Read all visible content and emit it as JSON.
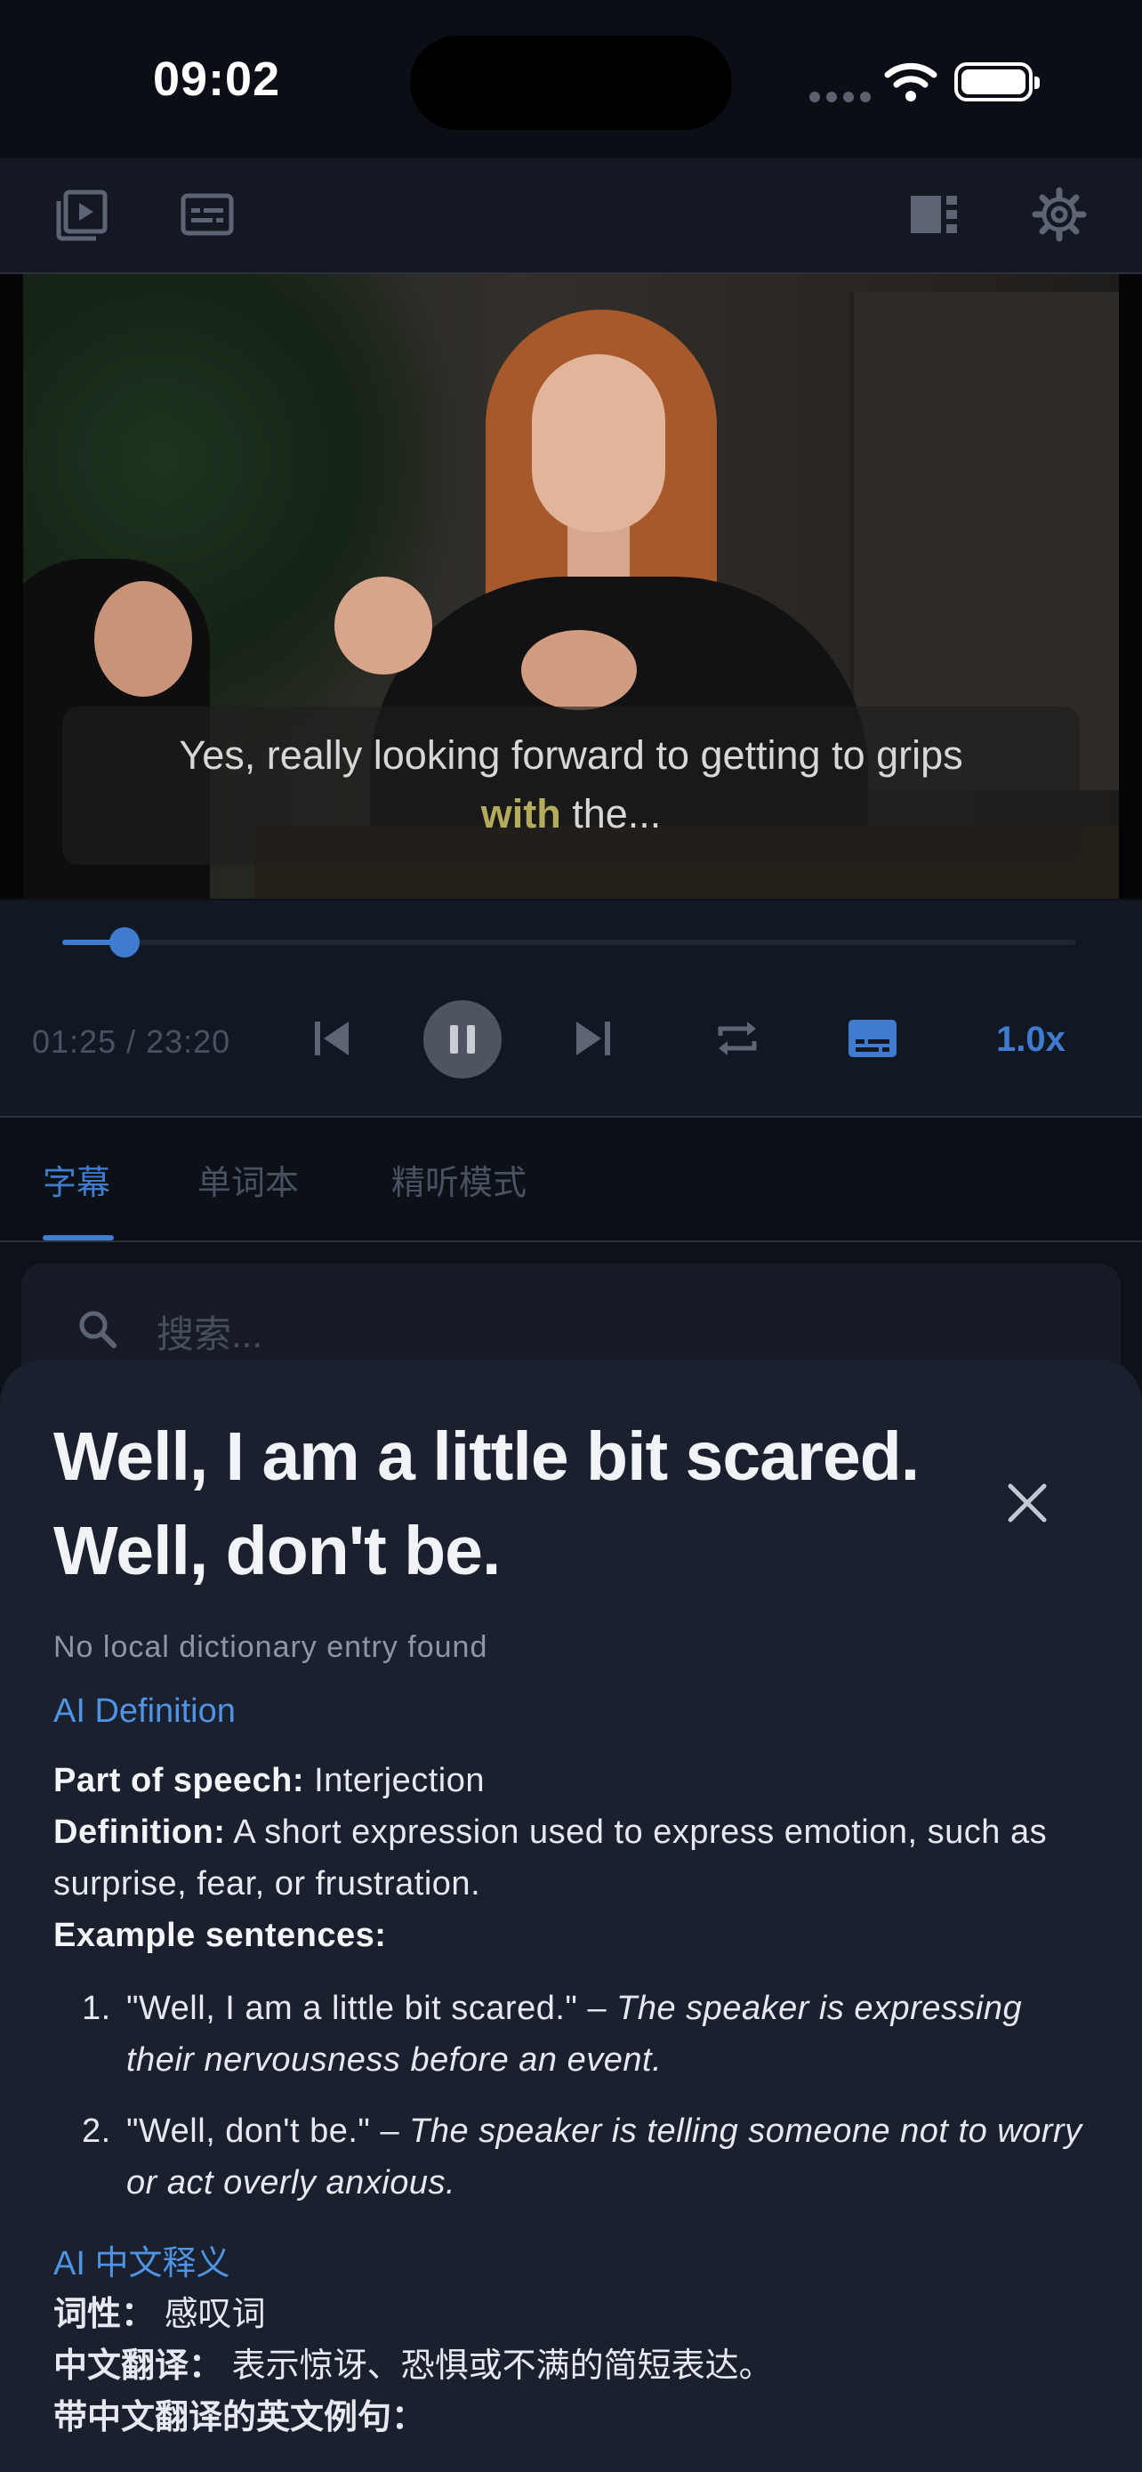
{
  "status_bar": {
    "time": "09:02"
  },
  "player": {
    "subtitle_before": "Yes, really looking forward to getting to grips",
    "subtitle_highlight": "with",
    "subtitle_after": " the...",
    "time_readout": "01:25 / 23:20",
    "progress_fraction": 0.061,
    "speed": "1.0x"
  },
  "tabs": [
    {
      "label": "字幕",
      "active": true
    },
    {
      "label": "单词本",
      "active": false
    },
    {
      "label": "精听模式",
      "active": false
    }
  ],
  "search": {
    "placeholder": "搜索..."
  },
  "sheet": {
    "title": "Well, I am a little bit scared. Well, don't be.",
    "no_entry": "No local dictionary entry found",
    "ai_definition_heading": "AI Definition",
    "pos_label": "Part of speech:",
    "pos_value": " Interjection",
    "def_label": "Definition:",
    "def_value": " A short expression used to express emotion, such as surprise, fear, or frustration.",
    "examples_label": "Example sentences:",
    "examples": [
      {
        "num": "1.",
        "quote": "\"Well, I am a little bit scared.\" – ",
        "note": "The speaker is expressing their nervousness before an event."
      },
      {
        "num": "2.",
        "quote": "\"Well, don't be.\" – ",
        "note": "The speaker is telling someone not to worry or act overly anxious."
      }
    ],
    "ai_cn_heading": "AI 中文释义",
    "cn_pos_label": "词性：",
    "cn_pos_value": " 感叹词",
    "cn_trans_label": "中文翻译：",
    "cn_trans_value": " 表示惊讶、恐惧或不满的简短表达。",
    "cn_examples_label": "带中文翻译的英文例句："
  },
  "colors": {
    "accent": "#3f7bcf",
    "highlight": "#b5ab5d",
    "sheet_bg": "#1a202d"
  }
}
